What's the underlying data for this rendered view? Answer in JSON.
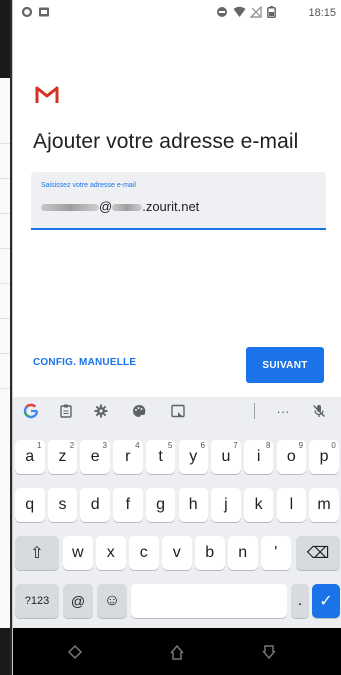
{
  "status_bar": {
    "time": "18:15"
  },
  "screen": {
    "title": "Ajouter votre adresse e-mail",
    "email_field": {
      "label": "Saisissez votre adresse e-mail",
      "value_at": "@",
      "value_suffix": ".zourit.net"
    },
    "manual_config_label": "CONFIG. MANUELLE",
    "next_label": "SUIVANT"
  },
  "keyboard": {
    "toolbar": [
      "google-icon",
      "clipboard-icon",
      "settings-icon",
      "palette-icon",
      "screenshot-icon",
      "more-icon",
      "mic-off-icon"
    ],
    "more_label": "···",
    "row1": [
      {
        "k": "a",
        "h": "1"
      },
      {
        "k": "z",
        "h": "2"
      },
      {
        "k": "e",
        "h": "3"
      },
      {
        "k": "r",
        "h": "4"
      },
      {
        "k": "t",
        "h": "5"
      },
      {
        "k": "y",
        "h": "6"
      },
      {
        "k": "u",
        "h": "7"
      },
      {
        "k": "i",
        "h": "8"
      },
      {
        "k": "o",
        "h": "9"
      },
      {
        "k": "p",
        "h": "0"
      }
    ],
    "row2": [
      "q",
      "s",
      "d",
      "f",
      "g",
      "h",
      "j",
      "k",
      "l",
      "m"
    ],
    "row3": [
      "w",
      "x",
      "c",
      "v",
      "b",
      "n",
      "'"
    ],
    "shift_symbol": "⇧",
    "backspace_symbol": "⌫",
    "symbols_label": "?123",
    "at_label": "@",
    "emoji_symbol": "☺",
    "period_label": ".",
    "enter_symbol": "✓"
  },
  "colors": {
    "accent": "#1a73e8",
    "gmail_red": "#d93025"
  }
}
